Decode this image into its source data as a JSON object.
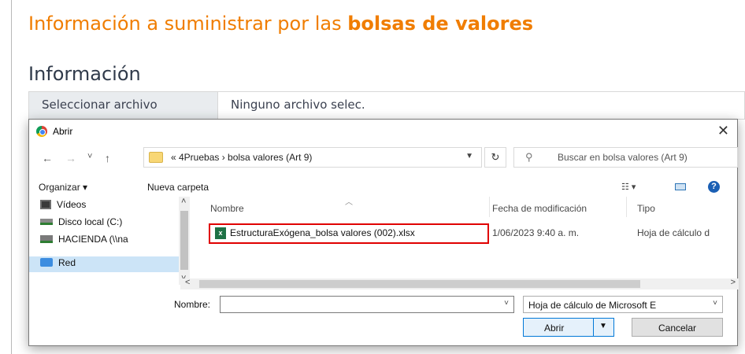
{
  "page": {
    "heading_prefix": "Información a suministrar por las ",
    "heading_bold": "bolsas de valores",
    "section_title": "Información",
    "file_button": "Seleccionar archivo",
    "file_status": "Ninguno archivo selec."
  },
  "dialog": {
    "title": "Abrir",
    "close": "✕",
    "nav": {
      "back": "←",
      "forward": "→",
      "history": "˅",
      "up": "↑"
    },
    "address": "« 4Pruebas  ›  bolsa valores (Art 9)",
    "search_placeholder": "Buscar en bolsa valores (Art 9)",
    "toolbar": {
      "organize": "Organizar ▾",
      "new_folder": "Nueva carpeta"
    },
    "sidebar": [
      {
        "label": "Vídeos"
      },
      {
        "label": "Disco local (C:)"
      },
      {
        "label": "HACIENDA (\\\\na"
      },
      {
        "label": "Red"
      }
    ],
    "columns": {
      "name": "Nombre",
      "modified": "Fecha de modificación",
      "type": "Tipo"
    },
    "files": [
      {
        "name": "EstructuraExógena_bolsa valores (002).xlsx",
        "modified": "1/06/2023 9:40 a. m.",
        "type": "Hoja de cálculo d"
      }
    ],
    "bottom": {
      "name_label": "Nombre:",
      "name_value": "",
      "type_filter": "Hoja de cálculo de Microsoft E",
      "open_label": "Abrir",
      "cancel_label": "Cancelar"
    }
  }
}
